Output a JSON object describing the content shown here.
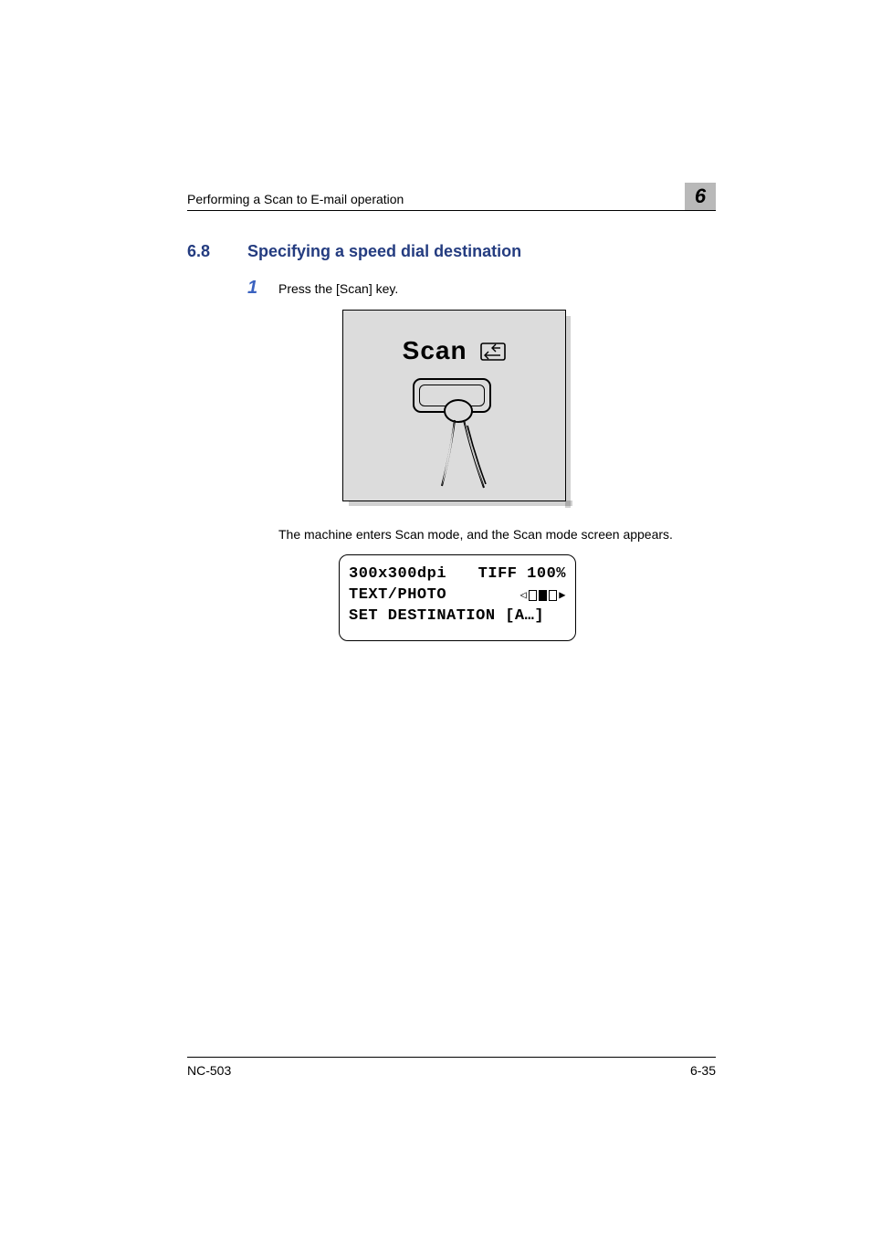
{
  "header": {
    "running_head": "Performing a Scan to E-mail operation",
    "chapter_number": "6"
  },
  "section": {
    "number": "6.8",
    "title": "Specifying a speed dial destination"
  },
  "steps": [
    {
      "number": "1",
      "text": "Press the [Scan] key."
    }
  ],
  "illustration": {
    "label": "Scan",
    "icon": "scan-to-pc-icon"
  },
  "result_text": "The machine enters Scan mode, and the Scan mode screen appears.",
  "lcd": {
    "line1_left": "300x300dpi",
    "line1_right": "TIFF 100%",
    "line2_left": "TEXT/PHOTO",
    "line3": "SET DESTINATION [A…]"
  },
  "footer": {
    "model": "NC-503",
    "page": "6-35"
  }
}
